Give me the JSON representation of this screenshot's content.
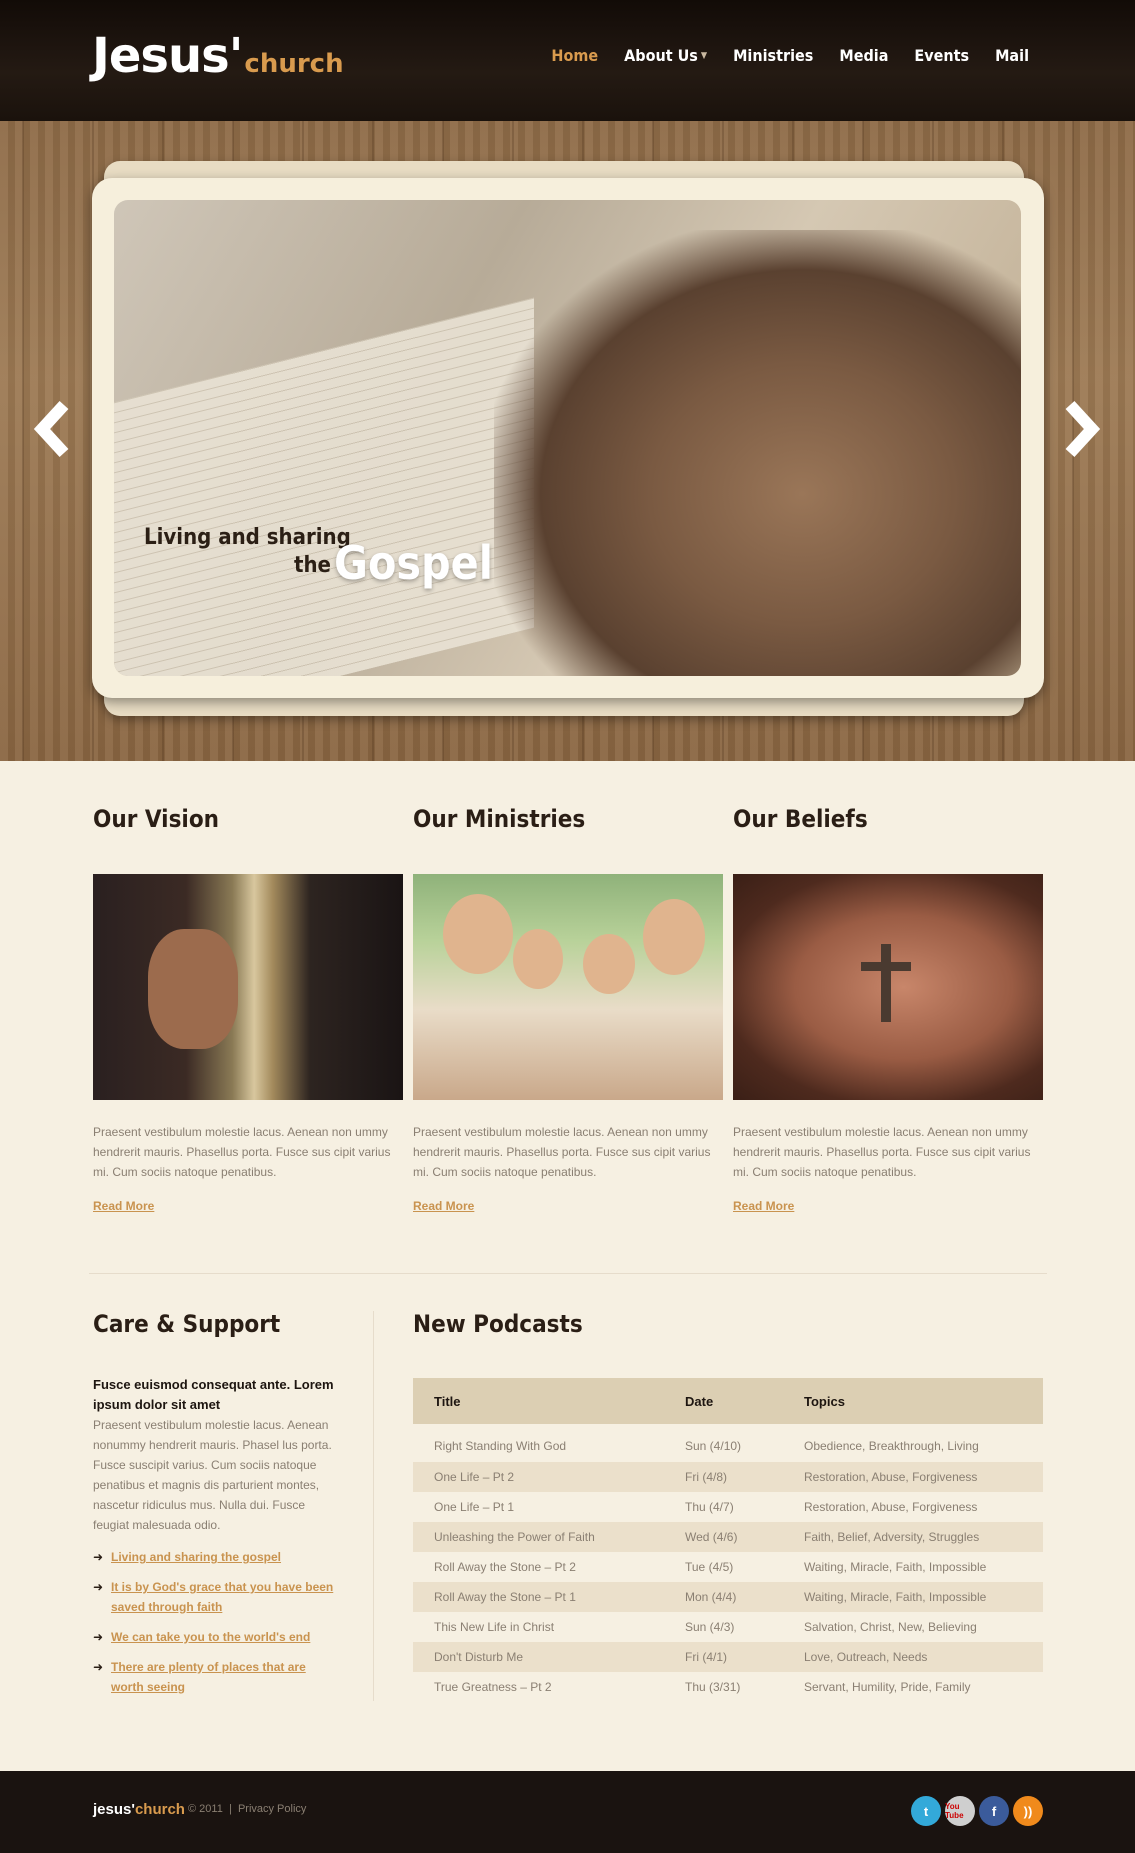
{
  "brand": {
    "main": "Jesus'",
    "sub": "church"
  },
  "nav": [
    {
      "label": "Home",
      "active": true
    },
    {
      "label": "About Us",
      "active": false,
      "dropdown": true
    },
    {
      "label": "Ministries",
      "active": false
    },
    {
      "label": "Media",
      "active": false
    },
    {
      "label": "Events",
      "active": false
    },
    {
      "label": "Mail",
      "active": false
    }
  ],
  "hero": {
    "line1": "Living and sharing",
    "line2": "the",
    "line3": "Gospel",
    "prev_icon": "chevron-left-icon",
    "next_icon": "chevron-right-icon"
  },
  "columns": [
    {
      "title": "Our Vision",
      "text": "Praesent vestibulum molestie lacus. Aenean non ummy hendrerit mauris. Phasellus porta. Fusce sus cipit varius mi. Cum sociis natoque penatibus.",
      "link": "Read More"
    },
    {
      "title": "Our Ministries",
      "text": "Praesent vestibulum molestie lacus. Aenean non ummy hendrerit mauris. Phasellus porta. Fusce sus cipit varius mi. Cum sociis natoque penatibus.",
      "link": "Read More"
    },
    {
      "title": "Our Beliefs",
      "text": "Praesent vestibulum molestie lacus. Aenean non ummy hendrerit mauris. Phasellus porta. Fusce sus cipit varius mi. Cum sociis natoque penatibus.",
      "link": "Read More"
    }
  ],
  "care": {
    "title": "Care & Support",
    "lead": "Fusce euismod consequat ante. Lorem ipsum dolor sit amet",
    "text": "Praesent vestibulum molestie lacus. Aenean nonummy hendrerit mauris. Phasel lus porta. Fusce suscipit varius. Cum sociis natoque penatibus et magnis dis parturient montes, nascetur ridiculus mus. Nulla dui. Fusce feugiat malesuada odio.",
    "links": [
      "Living and sharing the gospel",
      "It is by God's grace that you have been saved through faith",
      "We can take you to the world's end",
      "There are plenty of places that are worth seeing"
    ]
  },
  "podcasts": {
    "title": "New Podcasts",
    "headers": [
      "Title",
      "Date",
      "Topics"
    ],
    "rows": [
      {
        "title": "Right Standing With God",
        "date": "Sun (4/10)",
        "topics": "Obedience, Breakthrough, Living"
      },
      {
        "title": "One Life – Pt 2",
        "date": "Fri (4/8)",
        "topics": "Restoration, Abuse, Forgiveness"
      },
      {
        "title": "One Life – Pt 1",
        "date": "Thu (4/7)",
        "topics": "Restoration, Abuse, Forgiveness"
      },
      {
        "title": "Unleashing the Power of Faith",
        "date": "Wed (4/6)",
        "topics": "Faith, Belief, Adversity, Struggles"
      },
      {
        "title": "Roll Away the Stone – Pt 2",
        "date": "Tue (4/5)",
        "topics": "Waiting, Miracle, Faith, Impossible"
      },
      {
        "title": "Roll Away the Stone – Pt 1",
        "date": "Mon (4/4)",
        "topics": "Waiting, Miracle, Faith, Impossible"
      },
      {
        "title": "This New Life in Christ",
        "date": "Sun (4/3)",
        "topics": "Salvation, Christ, New, Believing"
      },
      {
        "title": "Don't Disturb Me",
        "date": "Fri (4/1)",
        "topics": "Love, Outreach, Needs"
      },
      {
        "title": "True Greatness – Pt 2",
        "date": "Thu (3/31)",
        "topics": "Servant, Humility, Pride, Family"
      }
    ]
  },
  "footer": {
    "logo_main": "jesus'",
    "logo_sub": "church",
    "copyright": "© 2011",
    "separator": "|",
    "privacy": "Privacy Policy",
    "social": [
      {
        "name": "twitter-icon",
        "glyph": "t"
      },
      {
        "name": "youtube-icon",
        "glyph": "You Tube"
      },
      {
        "name": "facebook-icon",
        "glyph": "f"
      },
      {
        "name": "rss-icon",
        "glyph": "))"
      }
    ]
  },
  "colors": {
    "accent": "#d99b4e",
    "link": "#c9934f",
    "background": "#f6f0e2",
    "header": "#1a120c",
    "table_head": "#dccfb3"
  }
}
